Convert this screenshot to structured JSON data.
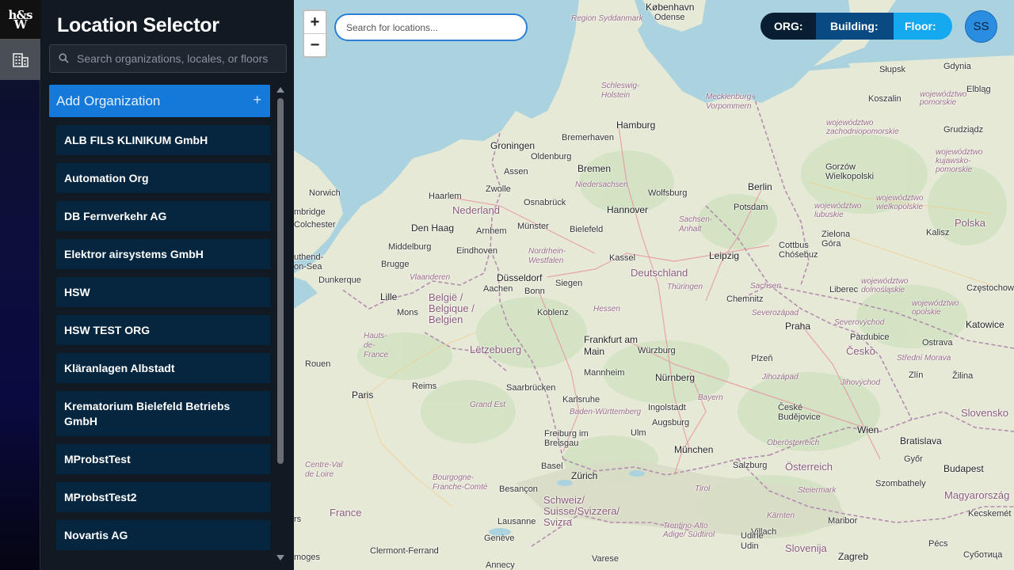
{
  "rail": {
    "logo_line1": "h&s",
    "logo_line2": "W",
    "building_icon": "building-icon"
  },
  "sidebar": {
    "title": "Location Selector",
    "search_placeholder": "Search organizations, locales, or floors",
    "add_org_label": "Add Organization",
    "add_org_icon": "+",
    "organizations": [
      "ALB FILS KLINIKUM GmbH",
      "Automation Org",
      "DB Fernverkehr AG",
      "Elektror airsystems GmbH",
      "HSW",
      "HSW TEST ORG",
      "Kläranlagen Albstadt",
      "Krematorium Bielefeld Betriebs GmbH",
      "MProbstTest",
      "MProbstTest2",
      "Novartis AG"
    ]
  },
  "map": {
    "zoom_in": "+",
    "zoom_out": "−",
    "search_placeholder": "Search for locations...",
    "breadcrumb": {
      "org": "ORG:",
      "building": "Building:",
      "floor": "Floor:"
    },
    "avatar_initials": "SS",
    "labels": {
      "kobenhavn": "København",
      "odense": "Odense",
      "syddanmark": "Region Syddanmark",
      "slupsk": "Słupsk",
      "gdynia": "Gdynia",
      "elblag": "Elbląg",
      "koszalin": "Koszalin",
      "zach_pom": "województwo pomorskie",
      "schleswig": "Schleswig-Holstein",
      "mecklenburg": "Mecklenburg-Vorpommern",
      "hamburg": "Hamburg",
      "zachodnio": "województwo zachodniopomorskie",
      "grudziadz": "Grudziądz",
      "bremerhaven": "Bremerhaven",
      "groningen": "Groningen",
      "oldenburg": "Oldenburg",
      "bremen": "Bremen",
      "kujawsko": "województwo kujawsko-pomorskie",
      "gorzow": "Gorzów Wielkopolski",
      "assen": "Assen",
      "niedersachsen": "Niedersachsen",
      "zwolle": "Zwolle",
      "wolfsburg": "Wolfsburg",
      "berlin": "Berlin",
      "norwich": "Norwich",
      "haarlem": "Haarlem",
      "nederland": "Nederland",
      "osnabruck": "Osnabrück",
      "hannover": "Hannover",
      "potsdam": "Potsdam",
      "wielkopolskie": "województwo wielkopolskie",
      "cambridge": "mbridge",
      "lubuskie": "województwo lubuskie",
      "colchester": "Colchester",
      "denhaag": "Den Haag",
      "arnhem": "Arnhem",
      "munster": "Münster",
      "bielefeld": "Bielefeld",
      "sachsen_anhalt": "Sachsen-Anhalt",
      "polska": "Polska",
      "kalisz": "Kalisz",
      "zielona": "Zielona Góra",
      "middelburg": "Middelburg",
      "eindhoven": "Eindhoven",
      "nrw": "Nordrhein-Westfalen",
      "kassel": "Kassel",
      "cottbus": "Cottbus Chóśebuz",
      "leipzig": "Leipzig",
      "southend": "uthend-on-Sea",
      "brugge": "Brugge",
      "dunkerque": "Dunkerque",
      "vlaanderen": "Vlaanderen",
      "dusseldorf": "Düsseldorf",
      "siegen": "Siegen",
      "deutschland": "Deutschland",
      "thuringen": "Thüringen",
      "sachsen": "Sachsen",
      "dolnoslaskie": "województwo dolnośląskie",
      "czestochowa": "Częstochowa",
      "lille": "Lille",
      "aachen": "Aachen",
      "bonn": "Bonn",
      "belgie": "België / Belgique / Belgien",
      "mons": "Mons",
      "koblenz": "Koblenz",
      "hessen": "Hessen",
      "chemnitz": "Chemnitz",
      "liberec": "Liberec",
      "opolskie": "województwo opolskie",
      "severozapad": "Severozápad",
      "praha": "Praha",
      "severovychod": "Severovýchod",
      "katowice": "Katowice",
      "hauts": "Hauts-de-France",
      "letzebuerg": "Lëtzebuerg",
      "frankfurt": "Frankfurt am Main",
      "wurzburg": "Würzburg",
      "pardubice": "Pardubice",
      "ostrava": "Ostrava",
      "cesko": "Česko",
      "rouen": "Rouen",
      "plzen": "Plzeň",
      "stredni": "Střední Morava",
      "mannheim": "Mannheim",
      "nurnberg": "Nürnberg",
      "reims": "Reims",
      "saarbrucken": "Saarbrücken",
      "jihozapad": "Jihozápad",
      "jihovychod": "Jihovýchod",
      "zlin": "Zlín",
      "zilina": "Žilina",
      "paris": "Paris",
      "karlsruhe": "Karlsruhe",
      "bayern": "Bayern",
      "grand_est": "Grand Est",
      "ingolstadt": "Ingolstadt",
      "ceske": "České Budějovice",
      "slovensko": "Slovensko",
      "bw": "Baden-Württemberg",
      "augsburg": "Augsburg",
      "freiburg": "Freiburg im Breisgau",
      "ulm": "Ulm",
      "wien": "Wien",
      "bratislava": "Bratislava",
      "munchen": "München",
      "oberosterreich": "Oberösterreich",
      "cvdl": "Centre-Val de Loire",
      "basel": "Basel",
      "zurich": "Zürich",
      "salzburg": "Salzburg",
      "osterreich": "Österreich",
      "gyor": "Győr",
      "budapest": "Budapest",
      "bourgogne": "Bourgogne-Franche-Comté",
      "besancon": "Besançon",
      "schweiz": "Schweiz/ Suisse/Svizzera/ Svizra",
      "tirol": "Tirol",
      "steiermark": "Steiermark",
      "szombathely": "Szombathely",
      "magyarorszag": "Magyarország",
      "france": "France",
      "lausanne": "Lausanne",
      "karnten": "Kärnten",
      "kecskemet": "Kecskemét",
      "trentino": "Trentino-Alto Adige/ Südtirol",
      "villach": "Villach",
      "maribor": "Maribor",
      "geneve": "Genève",
      "udine": "Udine Udin",
      "slovenija": "Slovenija",
      "pecs": "Pécs",
      "clermont": "Clermont-Ferrand",
      "limoges": "moges",
      "tours": "rs",
      "annecy": "Annecy",
      "varese": "Varese",
      "zagreb": "Zagreb",
      "subotica": "Суботица"
    }
  }
}
